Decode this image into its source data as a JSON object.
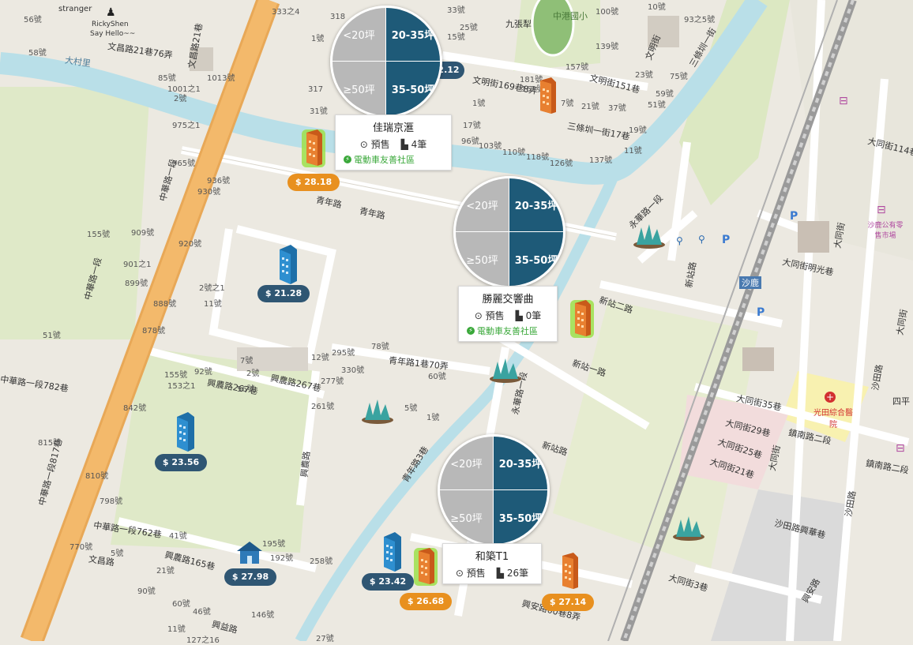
{
  "map": {
    "street_labels": [
      "中華路一段",
      "中華路一段",
      "中華路一段817巷",
      "中華路一段782巷",
      "中華路一段762巷",
      "文昌路",
      "文昌路21巷",
      "文昌路21巷76弄",
      "青年路",
      "青年路1巷70弄",
      "青年路3巷",
      "興農路",
      "興農路267巷",
      "興農路165巷",
      "興國路",
      "興益路",
      "興安路",
      "興安路60巷8弄",
      "永華路一段",
      "新站二路",
      "新站一路",
      "新站路",
      "大同街",
      "大同街35巷",
      "大同街29巷",
      "大同街25巷",
      "大同街21巷",
      "大同街3巷",
      "大同街114巷",
      "大同街明光巷",
      "大同街",
      "鎮南路二段",
      "鎮南路二段",
      "沙田路",
      "沙田路",
      "沙田路興華巷",
      "文明街",
      "文明街151巷",
      "文明街169巷8弄",
      "三條圳一街",
      "三條圳一街17巷",
      "文化路",
      "興安路",
      "大村里",
      "四平"
    ],
    "place_labels": [
      "九張犁",
      "中港國小",
      "沙鹿公有零售市場",
      "光田綜合醫院",
      "沙鹿",
      "RickyShen",
      "Say Hello~~",
      "stranger"
    ],
    "numbers": [
      "56號",
      "58號",
      "85號",
      "1013號",
      "1001之1",
      "2號",
      "31號",
      "975之1",
      "965號",
      "936號",
      "930號",
      "155號",
      "909號",
      "920號",
      "901之1",
      "899號",
      "888號",
      "878號",
      "51號",
      "11號",
      "2號之1",
      "12號",
      "295號",
      "78號",
      "330號",
      "277號",
      "261號",
      "60號",
      "5號",
      "1號",
      "155號",
      "153之1",
      "92號",
      "56號",
      "2號",
      "7號",
      "842號",
      "815號",
      "810號",
      "798號",
      "770號",
      "41號",
      "5號",
      "21號",
      "90號",
      "60號",
      "46號",
      "11號",
      "127之16",
      "27號",
      "195號",
      "192號",
      "258號",
      "146號",
      "17號",
      "110號",
      "118號",
      "126號",
      "137號",
      "11號",
      "103號",
      "96號",
      "139號",
      "157號",
      "100號",
      "51號",
      "75號",
      "23號",
      "59號",
      "19號",
      "37號",
      "21號",
      "7號",
      "181號",
      "162號",
      "1號",
      "1號",
      "333之4",
      "318",
      "317",
      "25號",
      "33號",
      "15號",
      "10號",
      "93之5號"
    ],
    "cluster_counts": [
      "2.12"
    ]
  },
  "projects": [
    {
      "wheel": [
        "<20坪",
        "20-35坪",
        "≥50坪",
        "35-50坪"
      ],
      "name": "佳瑞京滙",
      "status": "預售",
      "units": "4筆",
      "ev": "電動車友善社區"
    },
    {
      "wheel": [
        "<20坪",
        "20-35坪",
        "≥50坪",
        "35-50坪"
      ],
      "name": "勝麗交響曲",
      "status": "預售",
      "units": "0筆",
      "ev": "電動車友善社區"
    },
    {
      "wheel": [
        "<20坪",
        "20-35坪",
        "≥50坪",
        "35-50坪"
      ],
      "name": "和築T1",
      "status": "預售",
      "units": "26筆",
      "ev": ""
    }
  ],
  "prices": [
    {
      "label": "$ 28.18",
      "type": "orange"
    },
    {
      "label": "$ 21.28",
      "type": "blue"
    },
    {
      "label": "$ 23.56",
      "type": "blue"
    },
    {
      "label": "$ 27.98",
      "type": "blue"
    },
    {
      "label": "$ 23.42",
      "type": "blue"
    },
    {
      "label": "$ 26.68",
      "type": "orange"
    },
    {
      "label": "$ 27.14",
      "type": "orange"
    }
  ],
  "colors": {
    "wheel_dark": "#1e5a78",
    "wheel_light": "#b8b8b8",
    "price_blue": "#2f5673",
    "price_orange": "#e8901f",
    "ev_green": "#3aa83a",
    "road_main": "#f3b96b",
    "water": "#b9dfe8",
    "park": "#d8e6b8",
    "rail": "#9a9a9a"
  },
  "icons": [
    "building-blue-icon",
    "building-orange-icon",
    "house-icon",
    "grass-icon",
    "clock-icon",
    "building-count-icon",
    "ev-icon",
    "parking-icon",
    "bicycle-icon",
    "hospital-icon",
    "shopping-cart-icon",
    "market-icon"
  ]
}
